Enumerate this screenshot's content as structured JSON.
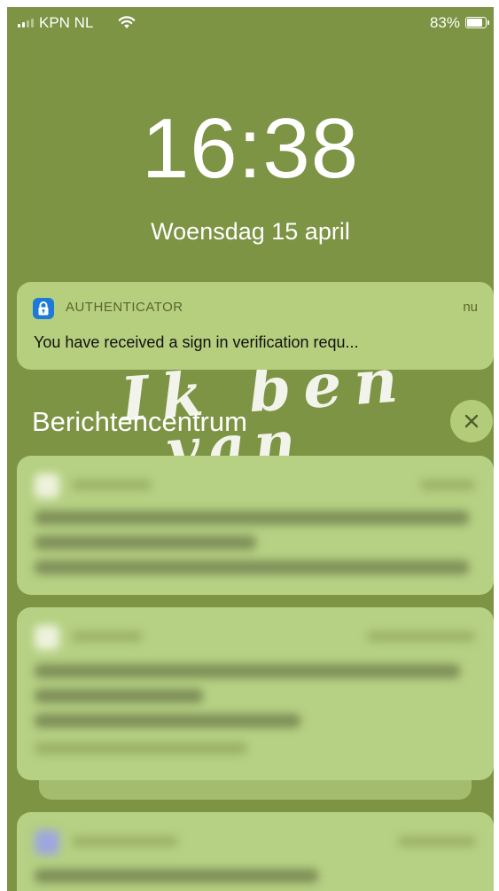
{
  "status_bar": {
    "carrier": "KPN NL",
    "battery_percent": "83%",
    "battery_level": 0.83,
    "signal_bars": 2
  },
  "lockscreen": {
    "time": "16:38",
    "date": "Woensdag 15 april"
  },
  "wallpaper": {
    "background_color": "#7c9443",
    "handwriting_line1": "Ik ben",
    "handwriting_line2": "van"
  },
  "notification": {
    "app_name": "AUTHENTICATOR",
    "time": "nu",
    "message": "You have received a sign in verification requ...",
    "icon": "lock-icon",
    "icon_color": "#1d7bd7"
  },
  "notification_center": {
    "title": "Berichtencentrum",
    "close_icon": "close-icon"
  },
  "colors": {
    "card": "#b6cf7e",
    "accent_text": "#59652f"
  }
}
